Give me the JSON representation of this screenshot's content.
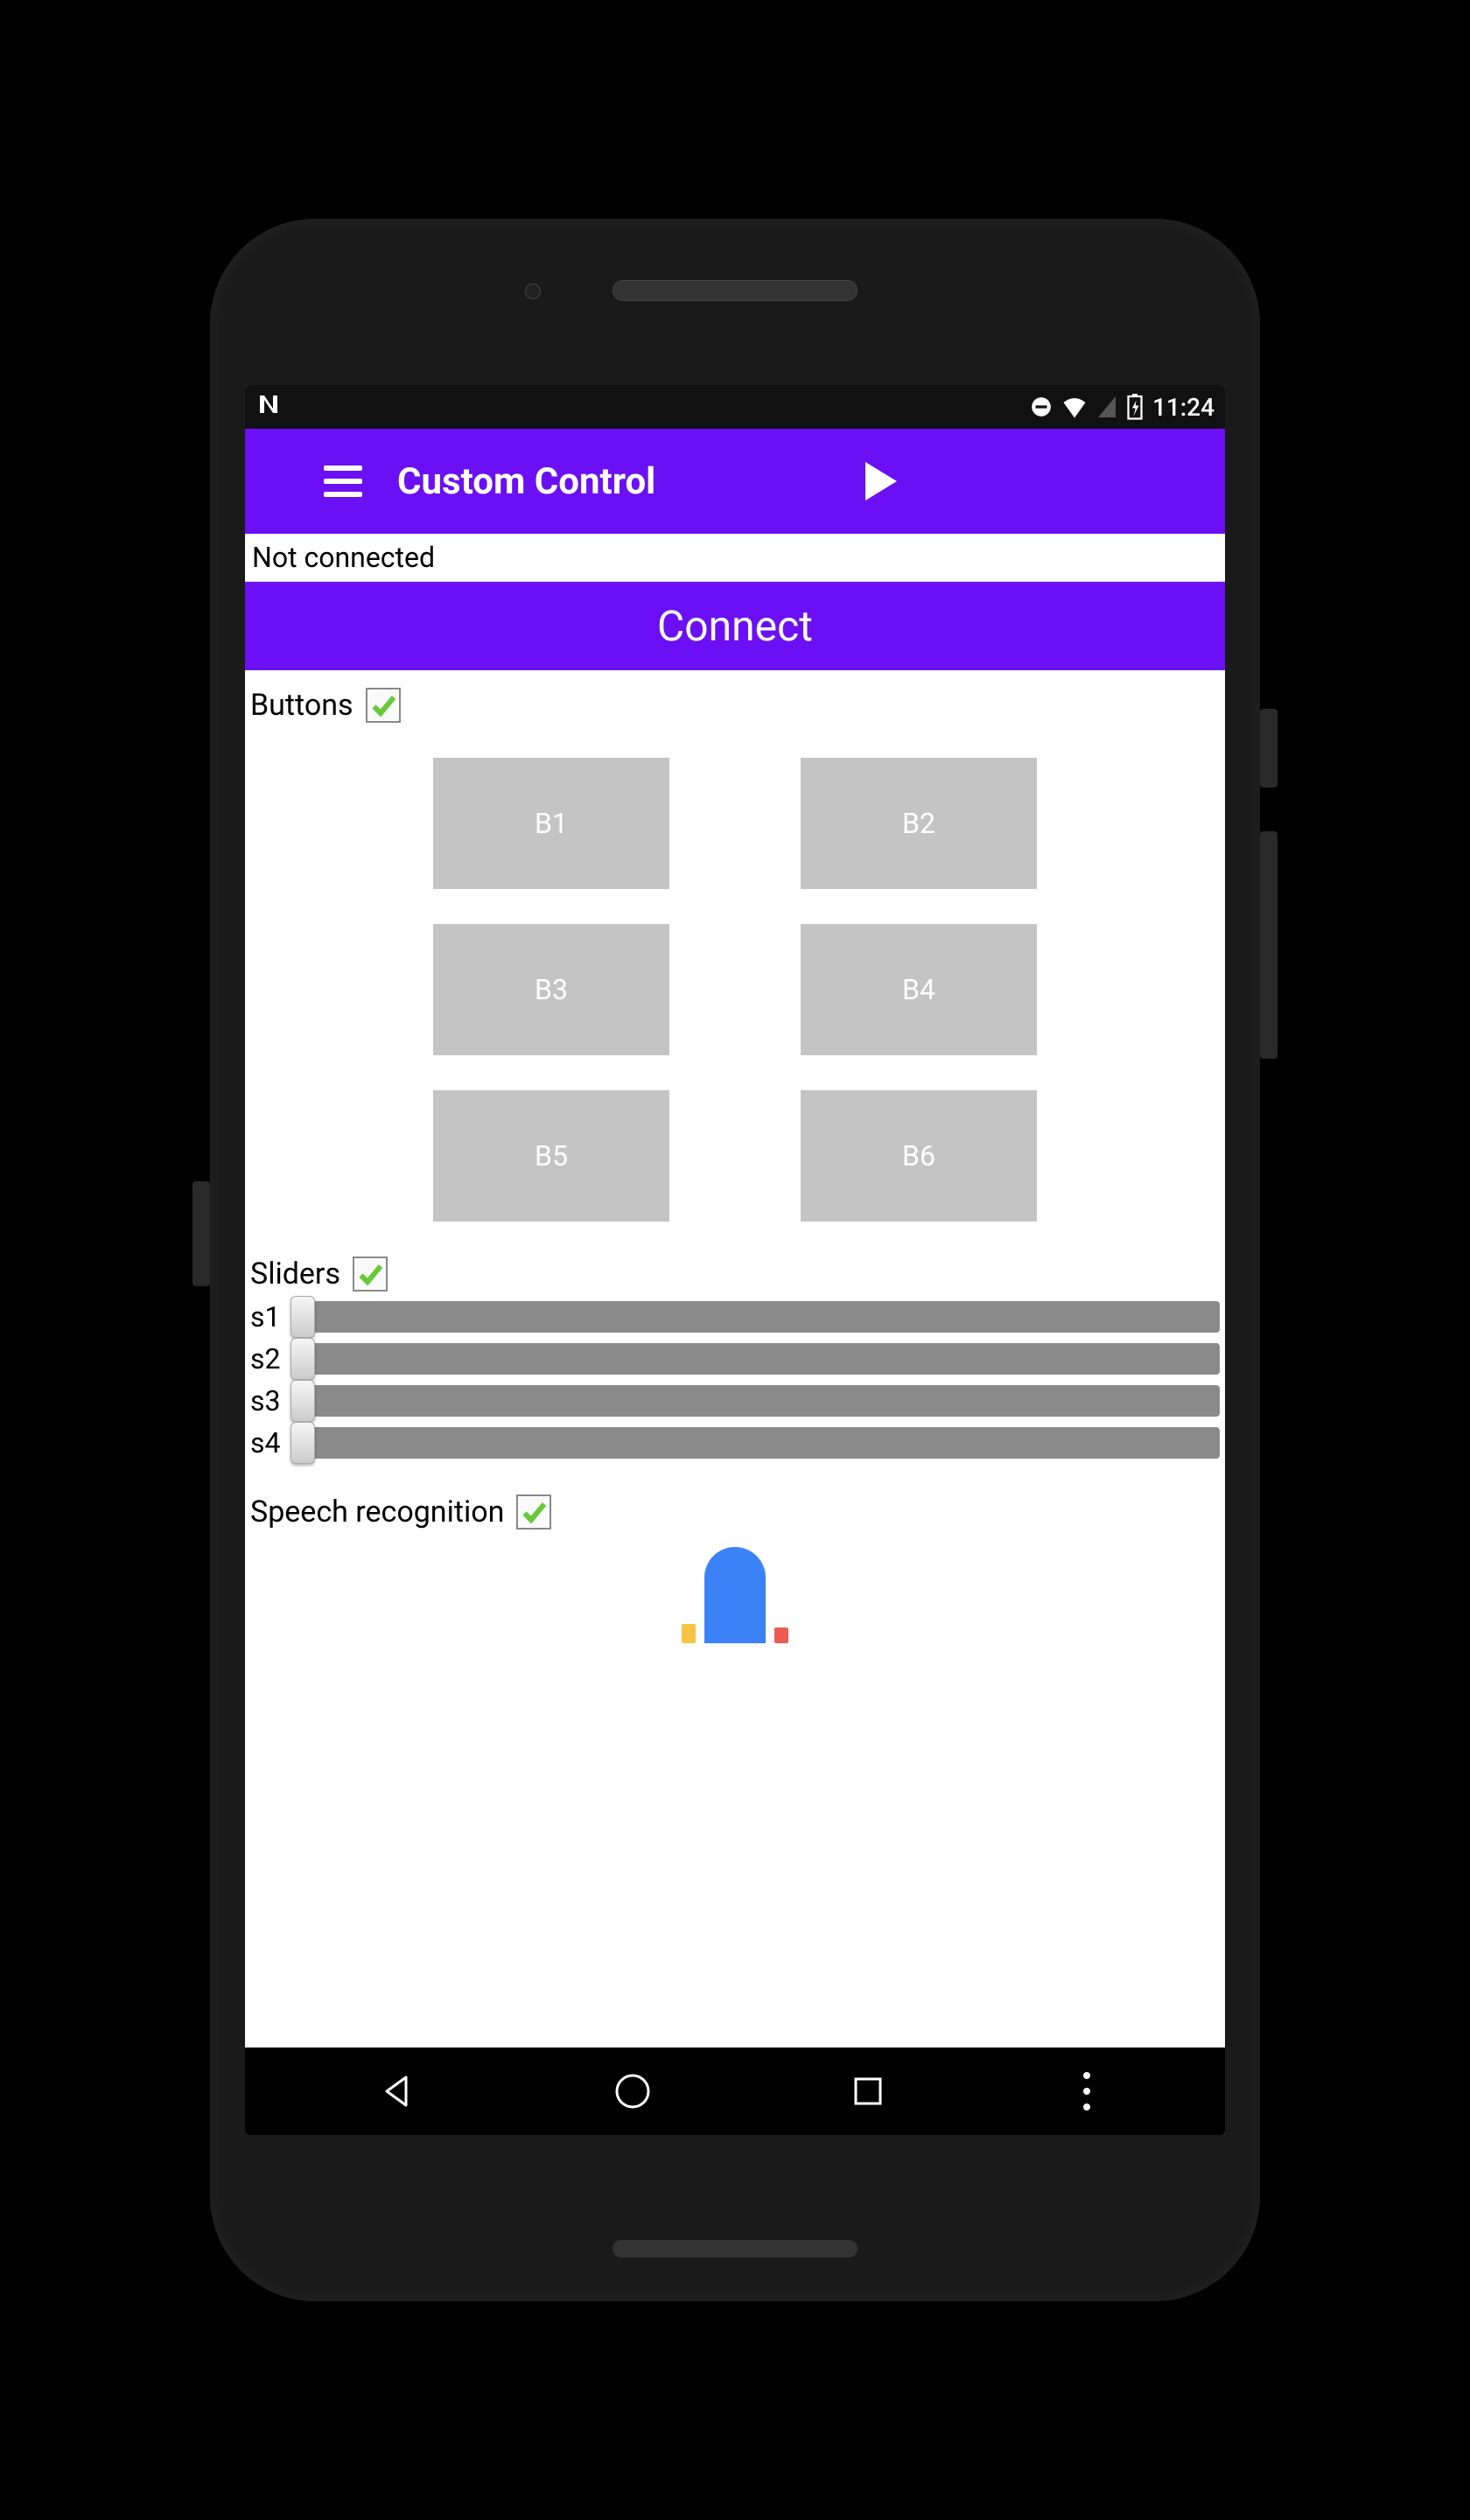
{
  "status_bar": {
    "time": "11:24"
  },
  "app_bar": {
    "title": "Custom Control"
  },
  "connection": {
    "status_text": "Not connected",
    "connect_label": "Connect"
  },
  "buttons_section": {
    "label": "Buttons",
    "checked": true,
    "items": [
      "B1",
      "B2",
      "B3",
      "B4",
      "B5",
      "B6"
    ]
  },
  "sliders_section": {
    "label": "Sliders",
    "checked": true,
    "items": [
      "s1",
      "s2",
      "s3",
      "s4"
    ]
  },
  "speech_section": {
    "label": "Speech recognition",
    "checked": true
  }
}
